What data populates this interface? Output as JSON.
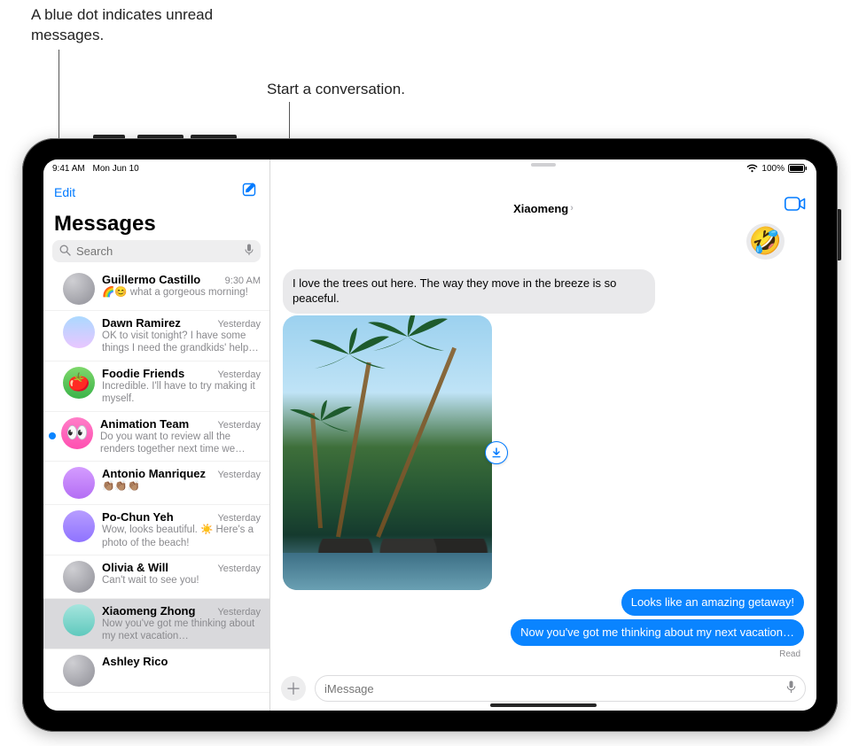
{
  "callouts": {
    "unread": "A blue dot indicates unread messages.",
    "compose": "Start a conversation."
  },
  "status": {
    "time": "9:41 AM",
    "date": "Mon Jun 10",
    "battery": "100%"
  },
  "sidebar": {
    "edit": "Edit",
    "title": "Messages",
    "search_placeholder": "Search"
  },
  "conversations": [
    {
      "name": "Guillermo Castillo",
      "time": "9:30 AM",
      "preview": "🌈😊 what a gorgeous morning!",
      "unread": false,
      "avatar_class": "av-grad-gray",
      "avatar_emoji": ""
    },
    {
      "name": "Dawn Ramirez",
      "time": "Yesterday",
      "preview": "OK to visit tonight? I have some things I need the grandkids' help…",
      "unread": false,
      "avatar_class": "av-blue",
      "avatar_emoji": ""
    },
    {
      "name": "Foodie Friends",
      "time": "Yesterday",
      "preview": "Incredible. I'll have to try making it myself.",
      "unread": false,
      "avatar_class": "av-green",
      "avatar_emoji": "🍅"
    },
    {
      "name": "Animation Team",
      "time": "Yesterday",
      "preview": "Do you want to review all the renders together next time we me…",
      "unread": true,
      "avatar_class": "av-pink",
      "avatar_emoji": "👀"
    },
    {
      "name": "Antonio Manriquez",
      "time": "Yesterday",
      "preview": "👏🏽👏🏽👏🏽",
      "unread": false,
      "avatar_class": "av-purplepink",
      "avatar_emoji": ""
    },
    {
      "name": "Po-Chun Yeh",
      "time": "Yesterday",
      "preview": "Wow, looks beautiful. ☀️ Here's a photo of the beach!",
      "unread": false,
      "avatar_class": "av-purple",
      "avatar_emoji": ""
    },
    {
      "name": "Olivia & Will",
      "time": "Yesterday",
      "preview": "Can't wait to see you!",
      "unread": false,
      "avatar_class": "av-grad-gray",
      "avatar_emoji": ""
    },
    {
      "name": "Xiaomeng Zhong",
      "time": "Yesterday",
      "preview": "Now you've got me thinking about my next vacation…",
      "unread": false,
      "avatar_class": "av-teal",
      "avatar_emoji": "",
      "selected": true
    },
    {
      "name": "Ashley Rico",
      "time": "",
      "preview": "",
      "unread": false,
      "avatar_class": "av-grad-gray",
      "avatar_emoji": ""
    }
  ],
  "chat": {
    "contact": "Xiaomeng",
    "tapback_emoji": "🤣",
    "incoming_text": "I love the trees out here. The way they move in the breeze is so peaceful.",
    "outgoing1": "Looks like an amazing getaway!",
    "outgoing2": "Now you've got me thinking about my next vacation…",
    "read_label": "Read",
    "input_placeholder": "iMessage"
  }
}
